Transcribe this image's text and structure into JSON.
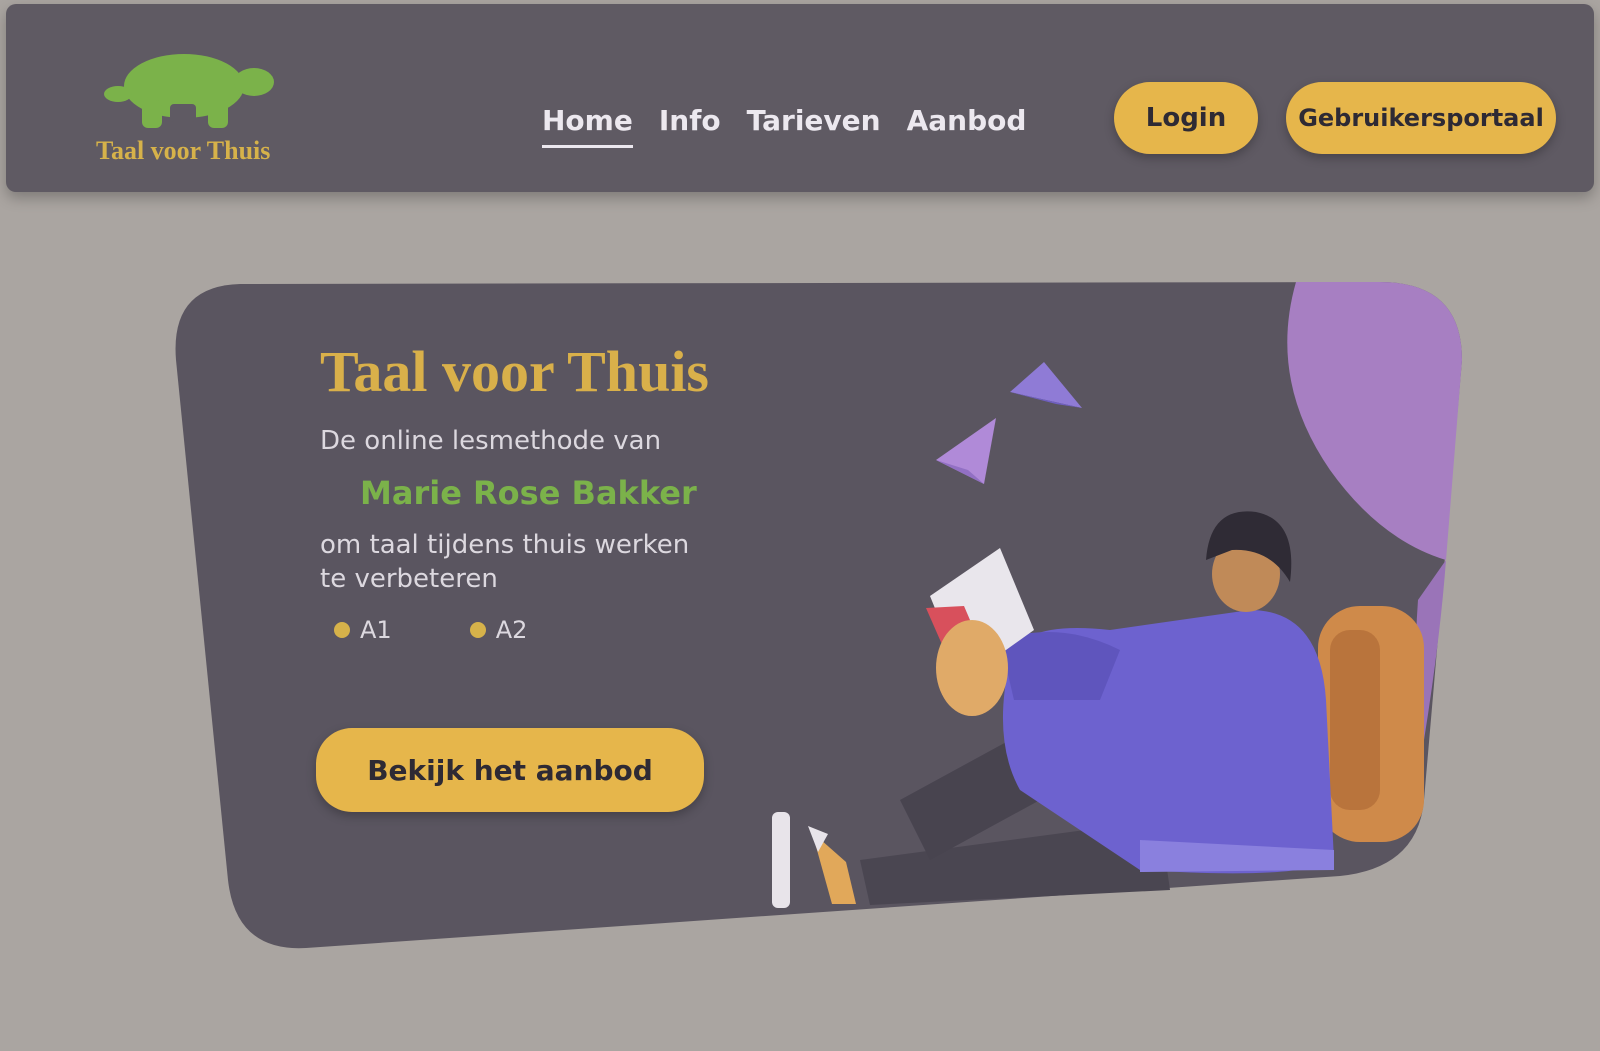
{
  "colors": {
    "page_background": "#aaa5a1",
    "nav_background": "#5f5a63",
    "card_background": "#5a5560",
    "accent_yellow": "#e6b64b",
    "accent_green": "#7bb24a",
    "accent_purple": "#a77fc2"
  },
  "brand": {
    "name": "Taal voor Thuis",
    "logo_icon": "turtle-icon"
  },
  "nav": {
    "links": [
      {
        "label": "Home",
        "active": true
      },
      {
        "label": "Info",
        "active": false
      },
      {
        "label": "Tarieven",
        "active": false
      },
      {
        "label": "Aanbod",
        "active": false
      }
    ],
    "login_label": "Login",
    "signup_label": "Gebruikersportaal"
  },
  "hero": {
    "title": "Taal voor Thuis",
    "line1": "De online lesmethode van",
    "highlight": "Marie Rose Bakker",
    "line2": "om taal tijdens thuis werken te verbeteren",
    "tags": [
      {
        "label": "A1",
        "icon": "check-icon"
      },
      {
        "label": "A2",
        "icon": "check-icon"
      }
    ],
    "cta_label": "Bekijk het aanbod",
    "illustration": "student-reading-on-backpack"
  }
}
